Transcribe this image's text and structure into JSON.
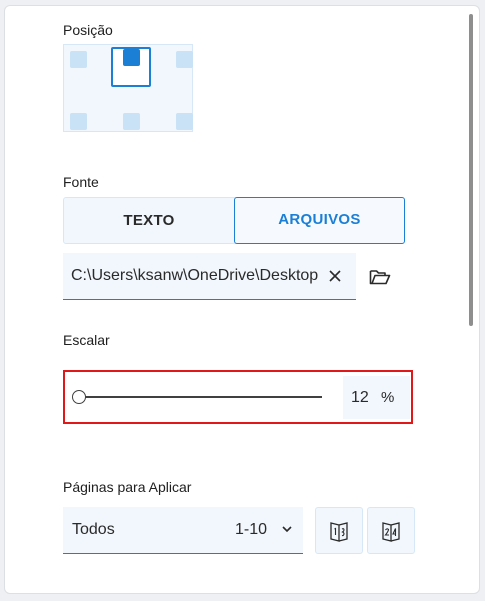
{
  "position": {
    "label": "Posição",
    "selected": "top-center"
  },
  "source": {
    "label": "Fonte",
    "options": [
      "TEXTO",
      "ARQUIVOS"
    ],
    "selected": "ARQUIVOS",
    "file_path": "C:\\Users\\ksanw\\OneDrive\\Desktop"
  },
  "scale": {
    "label": "Escalar",
    "value": "12",
    "unit": "%"
  },
  "pages": {
    "label": "Páginas para Aplicar",
    "selected": "Todos",
    "range": "1-10"
  },
  "icons": {
    "clear": "close-icon",
    "browse": "folder-open-icon",
    "dropdown": "chevron-down-icon",
    "odd_pages": "odd-pages-icon",
    "even_pages": "even-pages-icon"
  },
  "colors": {
    "accent": "#1b7fd6",
    "field_bg": "#f1f7fd",
    "position_cell": "#c9e2f6",
    "highlight": "#e01818"
  }
}
